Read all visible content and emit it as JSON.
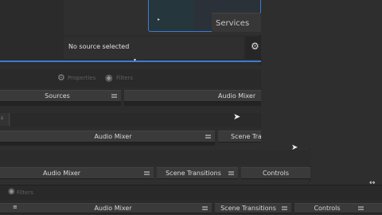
{
  "preview": {
    "services_label": "Services"
  },
  "source_bar": {
    "status_text": "No source selected"
  },
  "toolbar1": {
    "properties_label": "Properties",
    "filters_label": "Filters"
  },
  "row1": {
    "sources_label": "Sources",
    "audio_mixer_label": "Audio Mixer"
  },
  "row2": {
    "audio_mixer_label": "Audio Mixer",
    "scene_transitions_label": "Scene Tra"
  },
  "row3": {
    "audio_mixer_label": "Audio Mixer",
    "scene_transitions_label": "Scene Transitions",
    "controls_label": "Controls"
  },
  "toolbar2": {
    "filters_label": "Filters"
  },
  "row4": {
    "audio_mixer_label": "Audio Mixer",
    "scene_transitions_label": "Scene Transitions",
    "controls_label": "Controls"
  },
  "colors": {
    "accent": "#3b7cd4",
    "background": "#2e2e2e",
    "dock_title": "#3a3a3a"
  }
}
